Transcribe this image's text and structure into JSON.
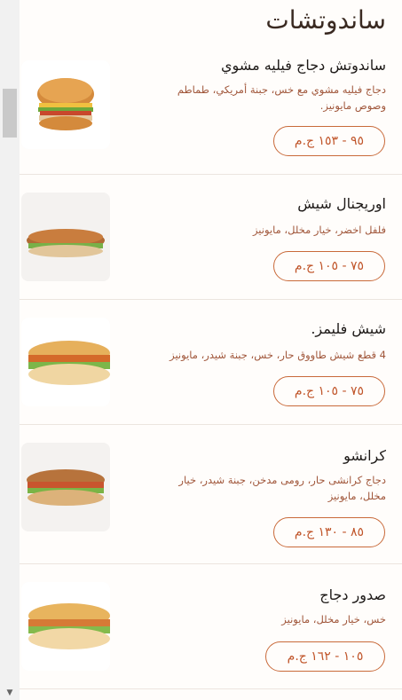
{
  "section": {
    "title": "ساندوتشات"
  },
  "items": [
    {
      "name": "ساندوتش دجاج فيليه مشوي",
      "description": "دجاج فيليه مشوي مع خس، جبنة أمريكي، طماطم وصوص مايونيز.",
      "price": "٩٥ - ١٥٣ ج.م",
      "image_icon": "burger-icon"
    },
    {
      "name": "اوريجنال شيش",
      "description": "فلفل اخضر، خيار مخلل، مايونيز",
      "price": "٧٥ - ١٠٥ ج.م",
      "image_icon": "sub-sandwich-icon"
    },
    {
      "name": "شيش فليمز.",
      "description": "4 قطع شيش طاووق حار، خس، جبنة شيدر، مايونيز",
      "price": "٧٥ - ١٠٥ ج.م",
      "image_icon": "sub-sandwich-icon"
    },
    {
      "name": "كرانشو",
      "description": "دجاج كرانشى حار، رومى مدخن، جبنة شيدر، خيار مخلل، مايونيز",
      "price": "٨٥ - ١٣٠ ج.م",
      "image_icon": "sub-sandwich-icon"
    },
    {
      "name": "صدور دجاج",
      "description": "خس، خيار مخلل، مايونيز",
      "price": "١٠٥ - ١٦٢ ج.م",
      "image_icon": "sub-sandwich-icon"
    }
  ]
}
